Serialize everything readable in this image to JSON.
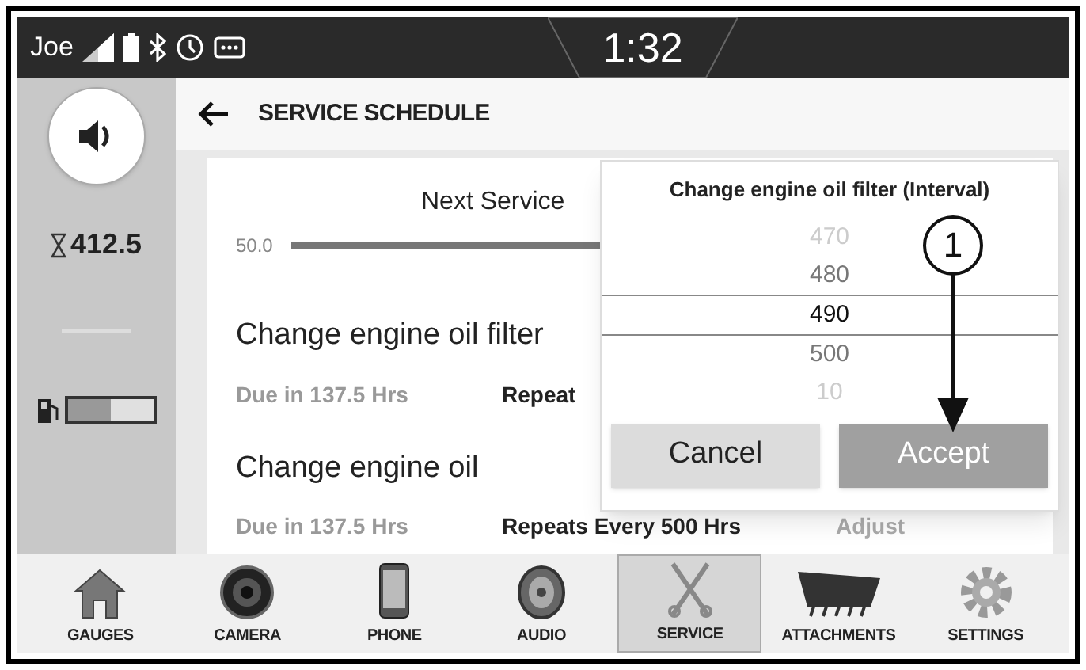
{
  "status_bar": {
    "user": "Joe",
    "clock": "1:32"
  },
  "sidebar": {
    "hours": "412.5",
    "fuel": {
      "level": 0.5
    }
  },
  "header": {
    "title": "SERVICE SCHEDULE"
  },
  "schedule": {
    "next_service": "Next Service",
    "slider_value": "50.0",
    "items": [
      {
        "title": "Change engine oil filter",
        "due": "Due in 137.5 Hrs",
        "repeat": "Repeat"
      },
      {
        "title": "Change engine oil",
        "due": "Due in 137.5 Hrs",
        "repeat": "Repeats Every 500 Hrs",
        "action": "Adjust"
      }
    ]
  },
  "dialog": {
    "title": "Change engine oil filter (Interval)",
    "options": [
      {
        "label": "470",
        "selected": false
      },
      {
        "label": "480",
        "selected": false
      },
      {
        "label": "490",
        "selected": true
      },
      {
        "label": "500",
        "selected": false
      },
      {
        "label": "10",
        "selected": false
      }
    ],
    "buttons": [
      {
        "label": "Cancel",
        "kind": "secondary"
      },
      {
        "label": "Accept",
        "kind": "primary"
      }
    ]
  },
  "callout": {
    "label": "1"
  },
  "nav": [
    {
      "label": "GAUGES",
      "selected": false
    },
    {
      "label": "CAMERA",
      "selected": false
    },
    {
      "label": "PHONE",
      "selected": false
    },
    {
      "label": "AUDIO",
      "selected": false
    },
    {
      "label": "SERVICE",
      "selected": true
    },
    {
      "label": "ATTACHMENTS",
      "selected": false
    },
    {
      "label": "SETTINGS",
      "selected": false
    }
  ]
}
